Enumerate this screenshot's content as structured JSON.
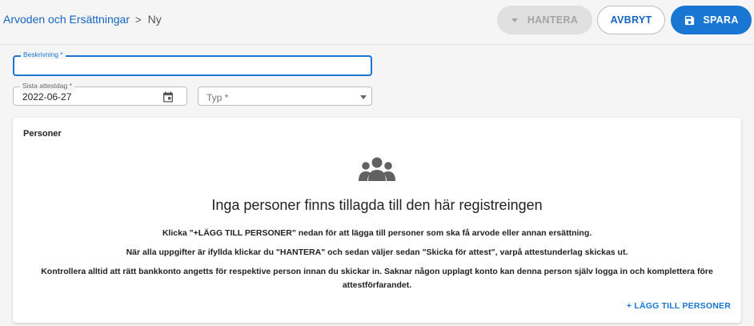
{
  "breadcrumb": {
    "parent": "Arvoden och Ersättningar",
    "separator": ">",
    "current": "Ny"
  },
  "toolbar": {
    "manage_label": "HANTERA",
    "cancel_label": "AVBRYT",
    "save_label": "SPARA"
  },
  "form": {
    "description_label": "Beskrivning *",
    "description_value": "",
    "last_attest_label": "Sista attestdag *",
    "last_attest_value": "2022-06-27",
    "type_label": "Typ *",
    "type_value": ""
  },
  "persons": {
    "title": "Personer",
    "empty_title": "Inga personer finns tillagda till den här registreingen",
    "info_1": "Klicka \"+LÄGG TILL PERSONER\" nedan för att lägga till personer som ska få arvode eller annan ersättning.",
    "info_2": "När alla uppgifter är ifyllda klickar du \"HANTERA\" och sedan väljer sedan \"Skicka för attest\", varpå attestunderlag skickas ut.",
    "info_3": "Kontrollera alltid att rätt bankkonto angetts för respektive person innan du skickar in. Saknar någon upplagt konto kan denna person själv logga in och komplettera före attestförfarandet.",
    "add_label": "+ LÄGG TILL PERSONER"
  },
  "icons": {
    "manage": "caret-down-icon",
    "save": "floppy-disk-icon",
    "date": "calendar-icon",
    "type": "dropdown-caret-icon",
    "empty_state": "people-group-icon"
  },
  "colors": {
    "primary": "#1976d2",
    "link": "#1565c0",
    "disabled_bg": "#e0e0e0",
    "disabled_text": "#a4a4a4"
  }
}
